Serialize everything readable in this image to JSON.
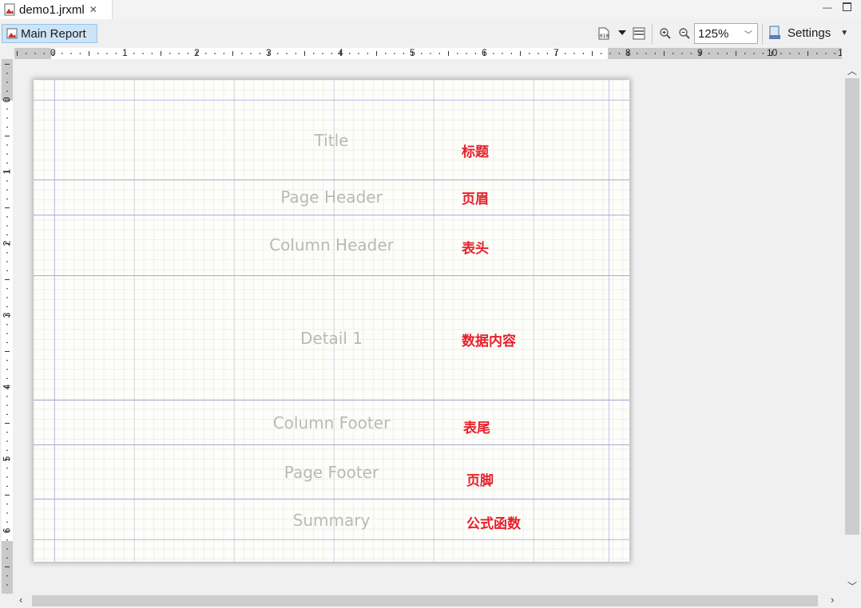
{
  "editor_tab": {
    "title": "demo1.jrxml",
    "close_icon": "close-icon"
  },
  "toolbar": {
    "report_tab_label": "Main Report",
    "zoom": {
      "value": "125%"
    },
    "settings_label": "Settings"
  },
  "rulers": {
    "horizontal": [
      "0",
      "1",
      "2",
      "3",
      "4",
      "5",
      "6",
      "7",
      "8",
      "9",
      "10",
      "1"
    ],
    "vertical": [
      "0",
      "1",
      "2",
      "3",
      "4",
      "5",
      "6"
    ]
  },
  "bands": [
    {
      "name": "Title",
      "annotation": "标题"
    },
    {
      "name": "Page Header",
      "annotation": "页眉"
    },
    {
      "name": "Column Header",
      "annotation": "表头"
    },
    {
      "name": "Detail 1",
      "annotation": "数据内容"
    },
    {
      "name": "Column Footer",
      "annotation": "表尾"
    },
    {
      "name": "Page Footer",
      "annotation": "页脚"
    },
    {
      "name": "Summary",
      "annotation": "公式函数"
    }
  ],
  "colors": {
    "annotation": "#e8202a",
    "band_label": "#b9b9b9",
    "band_line": "#a9a9d6",
    "selected_tab": "#cde4f7"
  }
}
